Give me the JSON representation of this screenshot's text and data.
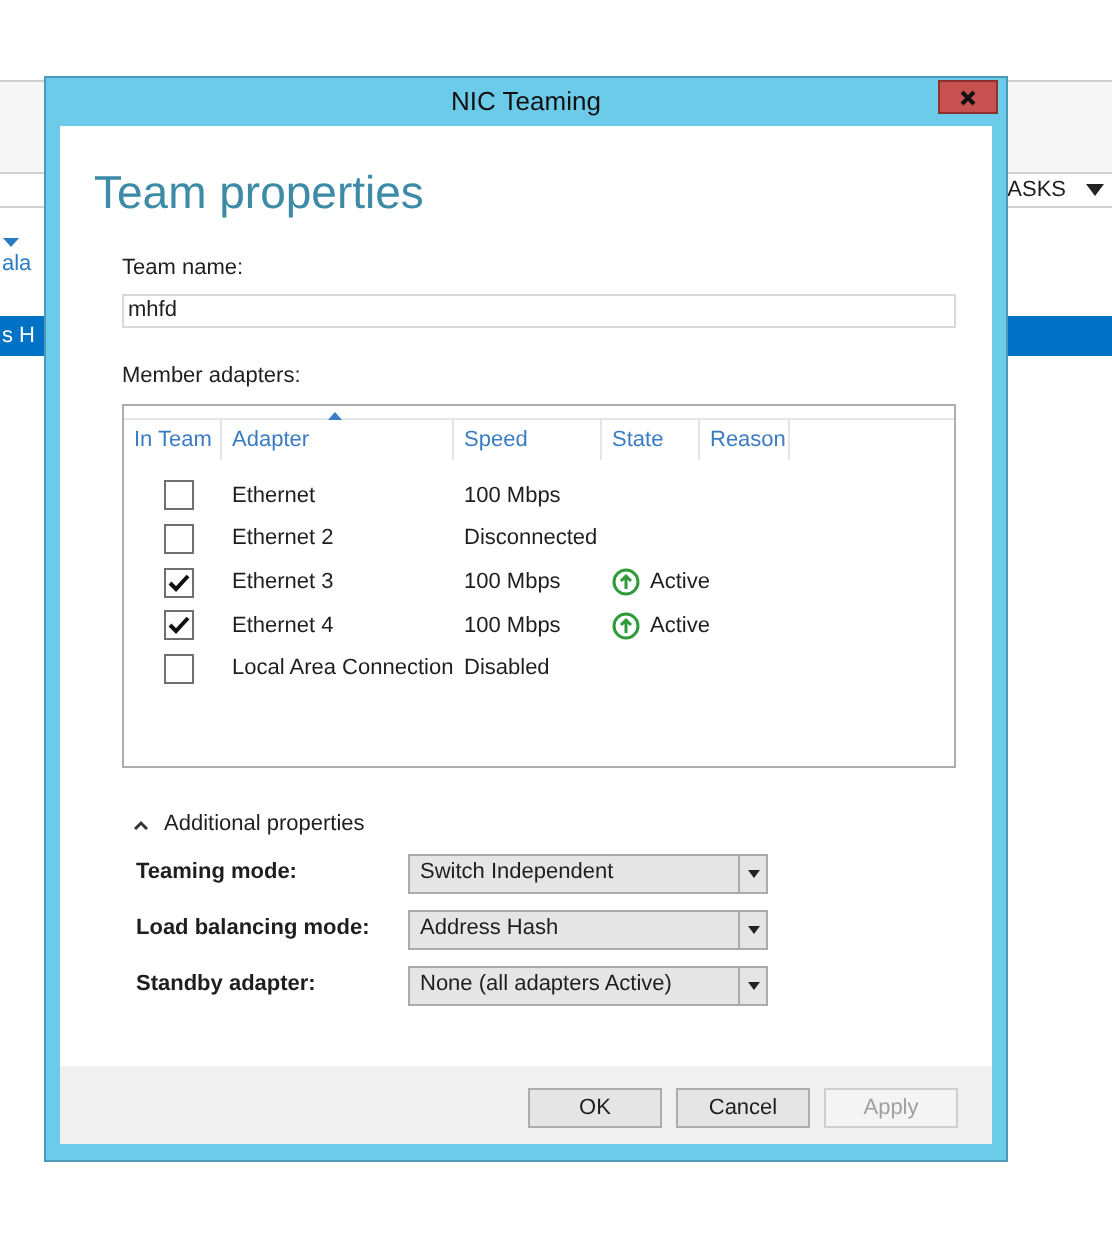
{
  "background": {
    "tasks_label": "ASKS",
    "column_header": "ala",
    "row_text": "s H"
  },
  "window": {
    "title": "NIC Teaming"
  },
  "heading": "Team properties",
  "team_name": {
    "label": "Team name:",
    "value": "mhfd"
  },
  "member_adapters": {
    "label": "Member adapters:",
    "columns": [
      {
        "label": "In Team",
        "sorted": false
      },
      {
        "label": "Adapter",
        "sorted": true
      },
      {
        "label": "Speed",
        "sorted": false
      },
      {
        "label": "State",
        "sorted": false
      },
      {
        "label": "Reason",
        "sorted": false
      }
    ],
    "rows": [
      {
        "in_team": false,
        "adapter": "Ethernet",
        "speed": "100 Mbps"
      },
      {
        "in_team": false,
        "adapter": "Ethernet 2",
        "speed": "Disconnected"
      },
      {
        "in_team": true,
        "adapter": "Ethernet 3",
        "speed": "100 Mbps",
        "state": "Active"
      },
      {
        "in_team": true,
        "adapter": "Ethernet 4",
        "speed": "100 Mbps",
        "state": "Active"
      },
      {
        "in_team": false,
        "adapter": "Local Area Connection",
        "speed": "Disabled"
      }
    ]
  },
  "additional_properties": {
    "label": "Additional properties",
    "expanded": true,
    "fields": [
      {
        "label": "Teaming mode:",
        "value": "Switch Independent"
      },
      {
        "label": "Load balancing mode:",
        "value": "Address Hash"
      },
      {
        "label": "Standby adapter:",
        "value": "None (all adapters Active)"
      }
    ]
  },
  "buttons": [
    {
      "label": "OK",
      "disabled": false
    },
    {
      "label": "Cancel",
      "disabled": false
    },
    {
      "label": "Apply",
      "disabled": true
    }
  ]
}
